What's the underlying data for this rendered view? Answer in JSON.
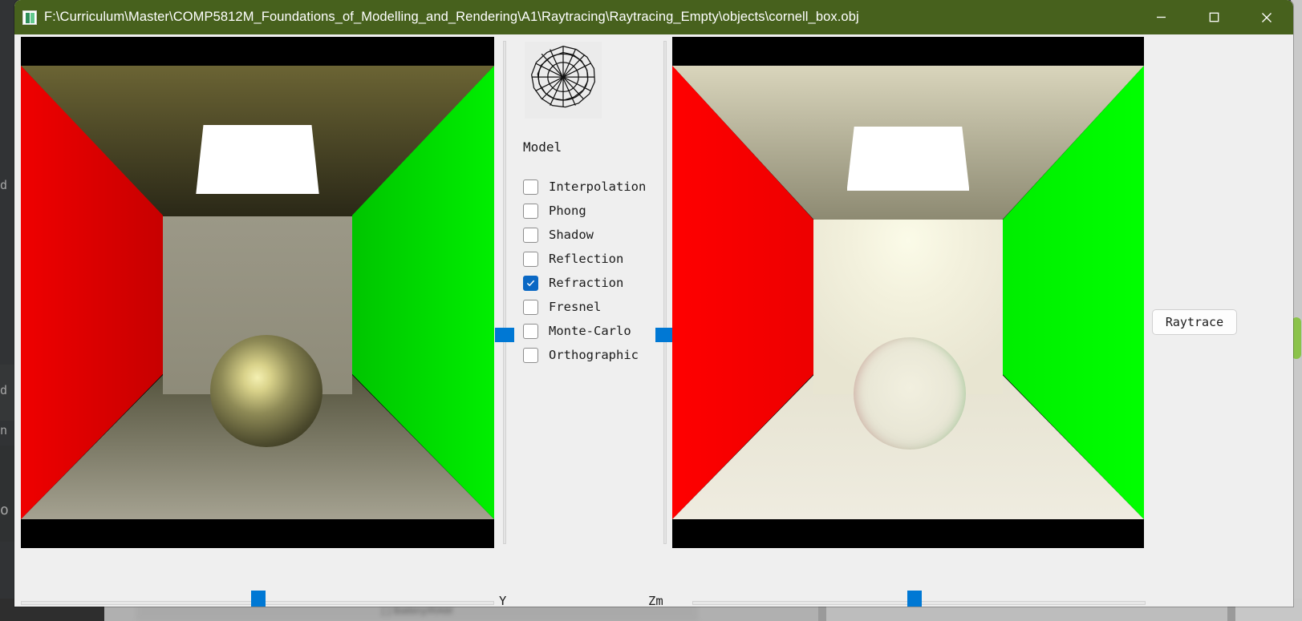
{
  "window": {
    "title": "F:\\Curriculum\\Master\\COMP5812M_Foundations_of_Modelling_and_Rendering\\A1\\Raytracing\\Raytracing_Empty\\objects\\cornell_box.obj",
    "icon": "app-window-icon",
    "controls": {
      "minimize_label": "—",
      "maximize_label": "□",
      "close_label": "✕"
    }
  },
  "panel": {
    "title": "Model",
    "arcball_name": "arcball-rotation-widget",
    "checkboxes": [
      {
        "label": "Interpolation",
        "checked": false,
        "name": "checkbox-interpolation"
      },
      {
        "label": "Phong",
        "checked": false,
        "name": "checkbox-phong"
      },
      {
        "label": "Shadow",
        "checked": false,
        "name": "checkbox-shadow"
      },
      {
        "label": "Reflection",
        "checked": false,
        "name": "checkbox-reflection"
      },
      {
        "label": "Refraction",
        "checked": true,
        "name": "checkbox-refraction"
      },
      {
        "label": "Fresnel",
        "checked": false,
        "name": "checkbox-fresnel"
      },
      {
        "label": "Monte-Carlo",
        "checked": false,
        "name": "checkbox-monte-carlo"
      },
      {
        "label": "Orthographic",
        "checked": false,
        "name": "checkbox-orthographic"
      }
    ]
  },
  "sliders": {
    "vertical_left": {
      "name": "vertical-slider-left",
      "value_pct": 50
    },
    "vertical_right": {
      "name": "vertical-slider-right",
      "value_pct": 50
    },
    "horizontal_left": {
      "label": "Y",
      "name": "horizontal-slider-y",
      "value_pct": 53
    },
    "horizontal_right": {
      "label": "Zm",
      "name": "horizontal-slider-zm",
      "value_pct": 50
    }
  },
  "actions": {
    "raytrace_label": "Raytrace"
  },
  "viewports": {
    "left": {
      "name": "opengl-preview-viewport",
      "description": "Cornell box OpenGL preview with shaded sphere"
    },
    "right": {
      "name": "raytraced-render-viewport",
      "description": "Cornell box raytraced render with refractive sphere"
    }
  },
  "colors": {
    "titlebar": "#47611d",
    "accent": "#0078d4",
    "checkbox_checked": "#0a68c4",
    "panel_bg": "#efefef",
    "wall_left": "#ff0000",
    "wall_right": "#00ff00",
    "scrollbar_thumb": "#8bc34a"
  },
  "background": {
    "ghost_chars": [
      "d",
      "d",
      "n",
      "o"
    ],
    "taskbar_text": "[ ] Battery/RAM"
  }
}
